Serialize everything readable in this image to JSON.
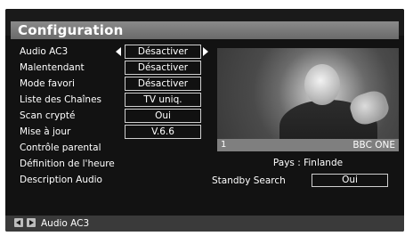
{
  "title": "Configuration",
  "menu": [
    {
      "label": "Audio AC3",
      "value": "Désactiver"
    },
    {
      "label": "Malentendant",
      "value": "Désactiver"
    },
    {
      "label": "Mode favori",
      "value": "Désactiver"
    },
    {
      "label": "Liste des Chaînes",
      "value": "TV uniq."
    },
    {
      "label": "Scan crypté",
      "value": "Oui"
    },
    {
      "label": "Mise à jour",
      "value": "V.6.6"
    },
    {
      "label": "Contrôle parental"
    },
    {
      "label": "Définition de l'heure"
    },
    {
      "label": "Description Audio"
    }
  ],
  "preview": {
    "channel_number": "1",
    "channel_name": "BBC ONE"
  },
  "country": "Pays : Finlande",
  "standby": {
    "label": "Standby Search",
    "value": "Oui"
  },
  "footer": {
    "hint": "Audio AC3"
  },
  "icons": [
    "arrow-left-icon",
    "arrow-right-icon",
    "nav-left-icon",
    "nav-right-icon"
  ]
}
